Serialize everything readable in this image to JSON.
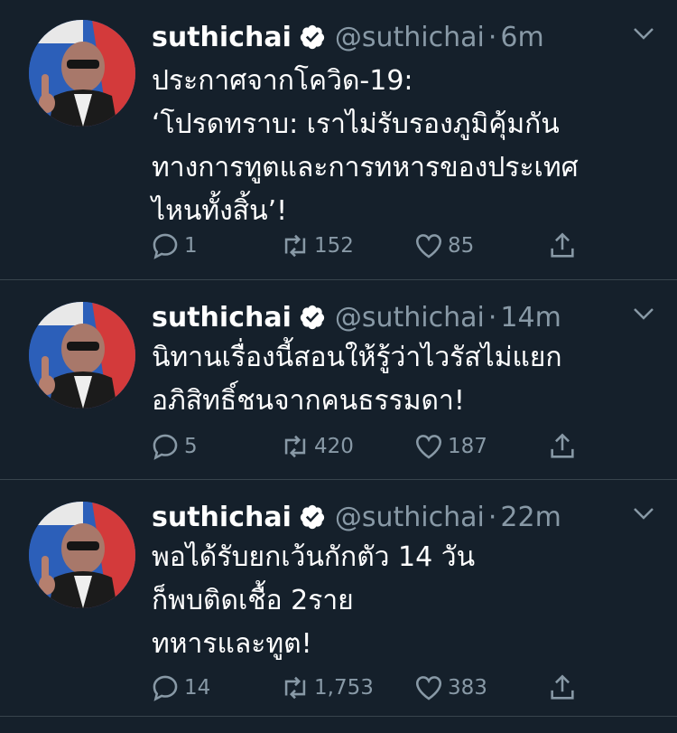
{
  "tweets": [
    {
      "name": "suthichai",
      "handle": "@suthichai",
      "separator": "·",
      "time": "6m",
      "text": "ประกาศจากโควิด-19:\n‘โปรดทราบ: เราไม่รับรองภูมิคุ้มกัน\nทางการทูตและการทหารของประเทศ\nไหนทั้งสิ้น’!",
      "replies": "1",
      "retweets": "152",
      "likes": "85"
    },
    {
      "name": "suthichai",
      "handle": "@suthichai",
      "separator": "·",
      "time": "14m",
      "text": "นิทานเรื่องนี้สอนให้รู้ว่าไวรัสไม่แยก\nอภิสิทธิ์ชนจากคนธรรมดา!",
      "replies": "5",
      "retweets": "420",
      "likes": "187"
    },
    {
      "name": "suthichai",
      "handle": "@suthichai",
      "separator": "·",
      "time": "22m",
      "text": "พอได้รับยกเว้นกักตัว 14 วัน\nก็พบติดเชื้อ 2ราย\nทหารและทูต!",
      "replies": "14",
      "retweets": "1,753",
      "likes": "383"
    }
  ],
  "icons": {
    "verified": "verified-badge-icon",
    "caret": "chevron-down-icon",
    "reply": "reply-icon",
    "retweet": "retweet-icon",
    "like": "heart-icon",
    "share": "share-icon"
  },
  "colors": {
    "background": "#15202b",
    "divider": "#38444d",
    "secondary_text": "#8899a6",
    "primary_text": "#ffffff"
  }
}
